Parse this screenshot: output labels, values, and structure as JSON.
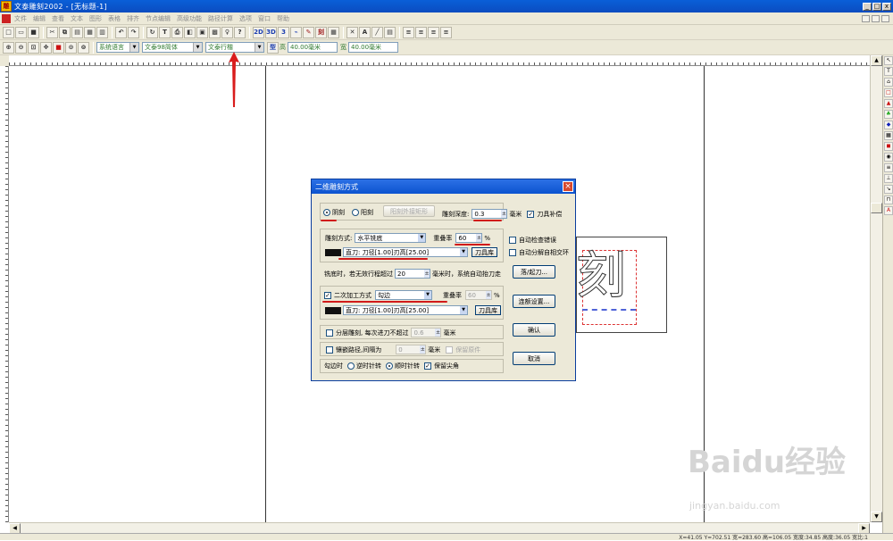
{
  "window": {
    "title": "文泰雕刻2002 - [无标题-1]"
  },
  "menu": [
    "文件",
    "编辑",
    "查看",
    "文本",
    "图形",
    "表格",
    "排齐",
    "节点编辑",
    "高级功能",
    "路径计算",
    "选项",
    "窗口",
    "帮助"
  ],
  "toolbar1": {
    "btn_2d": "2D",
    "btn_3d": "3D",
    "btn_3": "3",
    "btn_ci": "刻"
  },
  "toolbar2": {
    "language": "系统语言",
    "font": "文泰98简体",
    "line_style": "文泰行楷",
    "height_label": "高",
    "height_value": "40.00毫米",
    "width_label": "宽",
    "width_value": "40.00毫米"
  },
  "dialog": {
    "title": "二维雕刻方式",
    "radio_yinke": "阴刻",
    "radio_yangke": "阳刻",
    "btn_outer_rect": "阳刻外接矩形",
    "depth_label": "雕刻深度:",
    "depth_value": "0.3",
    "depth_unit": "毫米",
    "tool_comp": "刀具补偿",
    "engrave_mode_label": "雕刻方式:",
    "engrave_mode_value": "水平铣底",
    "overlap_label": "重叠率",
    "overlap_value": "60",
    "overlap_unit": "%",
    "tool1_value": "直刀: 刀径[1.00]刃高[25.00]",
    "tool_lib": "刀具库",
    "auto_check": "自动检查错误",
    "auto_split": "自动分解自相交环",
    "mill_text1": "铣底时，若无效行程超过",
    "mill_value": "20",
    "mill_text2": "毫米时，系统自动抬刀走",
    "btn_lift": "落/起刀...",
    "secondary_label": "二次加工方式",
    "secondary_value": "勾边",
    "overlap2_label": "重叠率",
    "overlap2_value": "60",
    "overlap2_unit": "%",
    "tool2_value": "直刀: 刀径[1.00]刃高[25.00]",
    "tool_lib2": "刀具库",
    "btn_connect": "连额设置...",
    "layer_label": "分层雕刻, 每次进刀不超过",
    "layer_value": "0.6",
    "layer_unit": "毫米",
    "inlay_label": "镶嵌路径,间隔为",
    "inlay_value": "0",
    "inlay_unit": "毫米",
    "keep_original": "保留原件",
    "hook_label": "勾边时",
    "ccw": "逆时针转",
    "cw": "顺时针转",
    "keep_sharp": "保留尖角",
    "btn_ok": "确认",
    "btn_cancel": "取消"
  },
  "canvas": {
    "glyph": "刻"
  },
  "status": {
    "text": "X=41.05 Y=702.51  宽=283.60 高=106.05  宽度:34.85 高度:36.05 宽比:1"
  },
  "watermark": {
    "main": "Baidu经验",
    "sub": "jingyan.baidu.com"
  }
}
